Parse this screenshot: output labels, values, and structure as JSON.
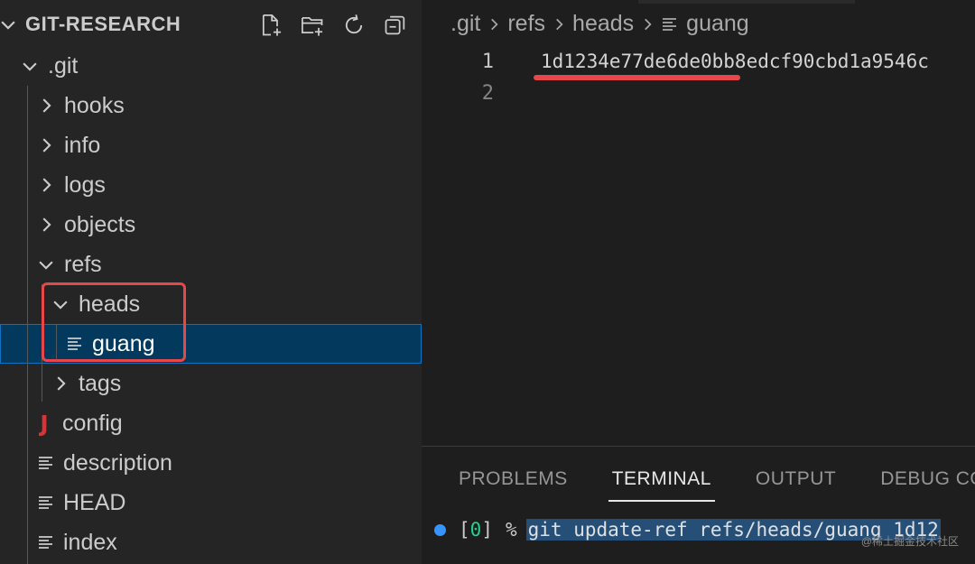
{
  "explorer": {
    "title": "GIT-RESEARCH",
    "actions": [
      {
        "icon": "new-file-icon"
      },
      {
        "icon": "new-folder-icon"
      },
      {
        "icon": "refresh-icon"
      },
      {
        "icon": "collapse-all-icon"
      }
    ],
    "tree": {
      "git": ".git",
      "hooks": "hooks",
      "info": "info",
      "logs": "logs",
      "objects": "objects",
      "refs": "refs",
      "heads": "heads",
      "guang": "guang",
      "tags": "tags",
      "config": "config",
      "config_icon": "J",
      "description": "description",
      "head": "HEAD",
      "index": "index"
    }
  },
  "editor": {
    "breadcrumb": [
      ".git",
      "refs",
      "heads",
      "guang"
    ],
    "lines": [
      {
        "number": "1",
        "text": "1d1234e77de6de0bb8edcf90cbd1a9546c"
      },
      {
        "number": "2",
        "text": ""
      }
    ]
  },
  "panel": {
    "tabs": [
      "PROBLEMS",
      "TERMINAL",
      "OUTPUT",
      "DEBUG CO"
    ],
    "active_tab": "TERMINAL",
    "terminal": {
      "exit_open": "[",
      "exit_code": "0",
      "exit_close": "]",
      "prompt": "%",
      "command": "git update-ref refs/heads/guang 1d12"
    }
  },
  "watermark": "@稀土掘金技术社区",
  "colors": {
    "sidebar_bg": "#252526",
    "editor_bg": "#1e1e1e",
    "selection_bg": "#04395e",
    "highlight_red": "#e84749",
    "terminal_dot": "#3794ff"
  }
}
